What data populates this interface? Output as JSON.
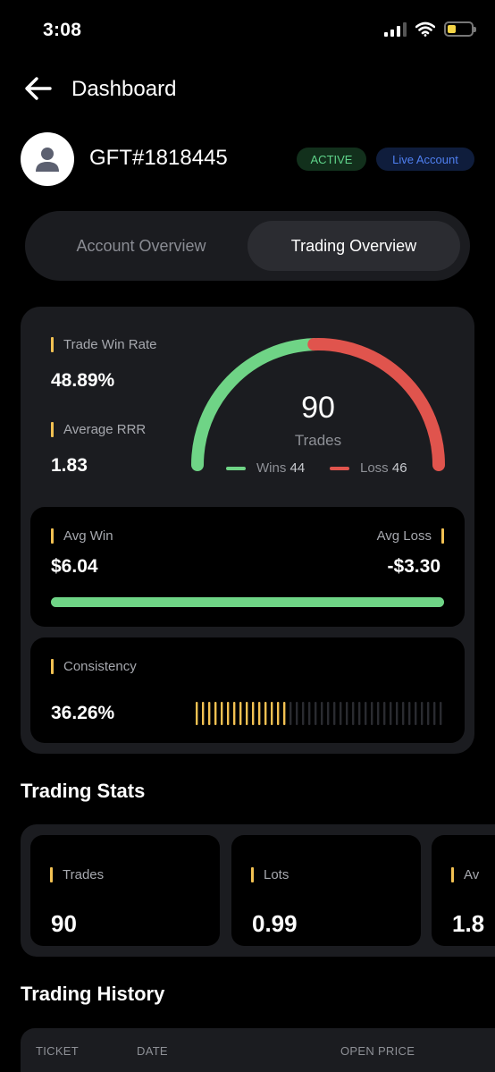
{
  "status_bar": {
    "time": "3:08",
    "icons": [
      "signal-icon",
      "wifi-icon",
      "battery-icon"
    ]
  },
  "header": {
    "title": "Dashboard",
    "back_icon": "arrow-left-icon"
  },
  "account": {
    "id": "GFT#1818445",
    "status_badge": "ACTIVE",
    "type_badge": "Live Account",
    "avatar_icon": "user-icon"
  },
  "tabs": [
    {
      "label": "Account Overview",
      "selected": false
    },
    {
      "label": "Trading Overview",
      "selected": true
    }
  ],
  "overview": {
    "win_rate_label": "Trade Win Rate",
    "win_rate_value": "48.89%",
    "rrr_label": "Average RRR",
    "rrr_value": "1.83",
    "gauge": {
      "total": "90",
      "total_label": "Trades",
      "wins_label": "Wins",
      "wins": "44",
      "loss_label": "Loss",
      "loss": "46",
      "win_fraction": 0.4889
    },
    "avg_win_label": "Avg Win",
    "avg_win_value": "$6.04",
    "avg_loss_label": "Avg Loss",
    "avg_loss_value": "-$3.30",
    "avg_bar_fraction": 1.0,
    "consistency_label": "Consistency",
    "consistency_value": "36.26%",
    "consistency_fraction": 0.3626
  },
  "trading_stats": {
    "title": "Trading Stats",
    "cards": [
      {
        "label": "Trades",
        "value": "90"
      },
      {
        "label": "Lots",
        "value": "0.99"
      },
      {
        "label": "Av",
        "value": "1.8"
      }
    ]
  },
  "trading_history": {
    "title": "Trading History",
    "columns": [
      "TICKET",
      "DATE",
      "OPEN PRICE"
    ]
  },
  "colors": {
    "win": "#6fd486",
    "loss": "#e0544d",
    "accent_bar": "#f2c152",
    "card_bg": "#1b1c20"
  }
}
